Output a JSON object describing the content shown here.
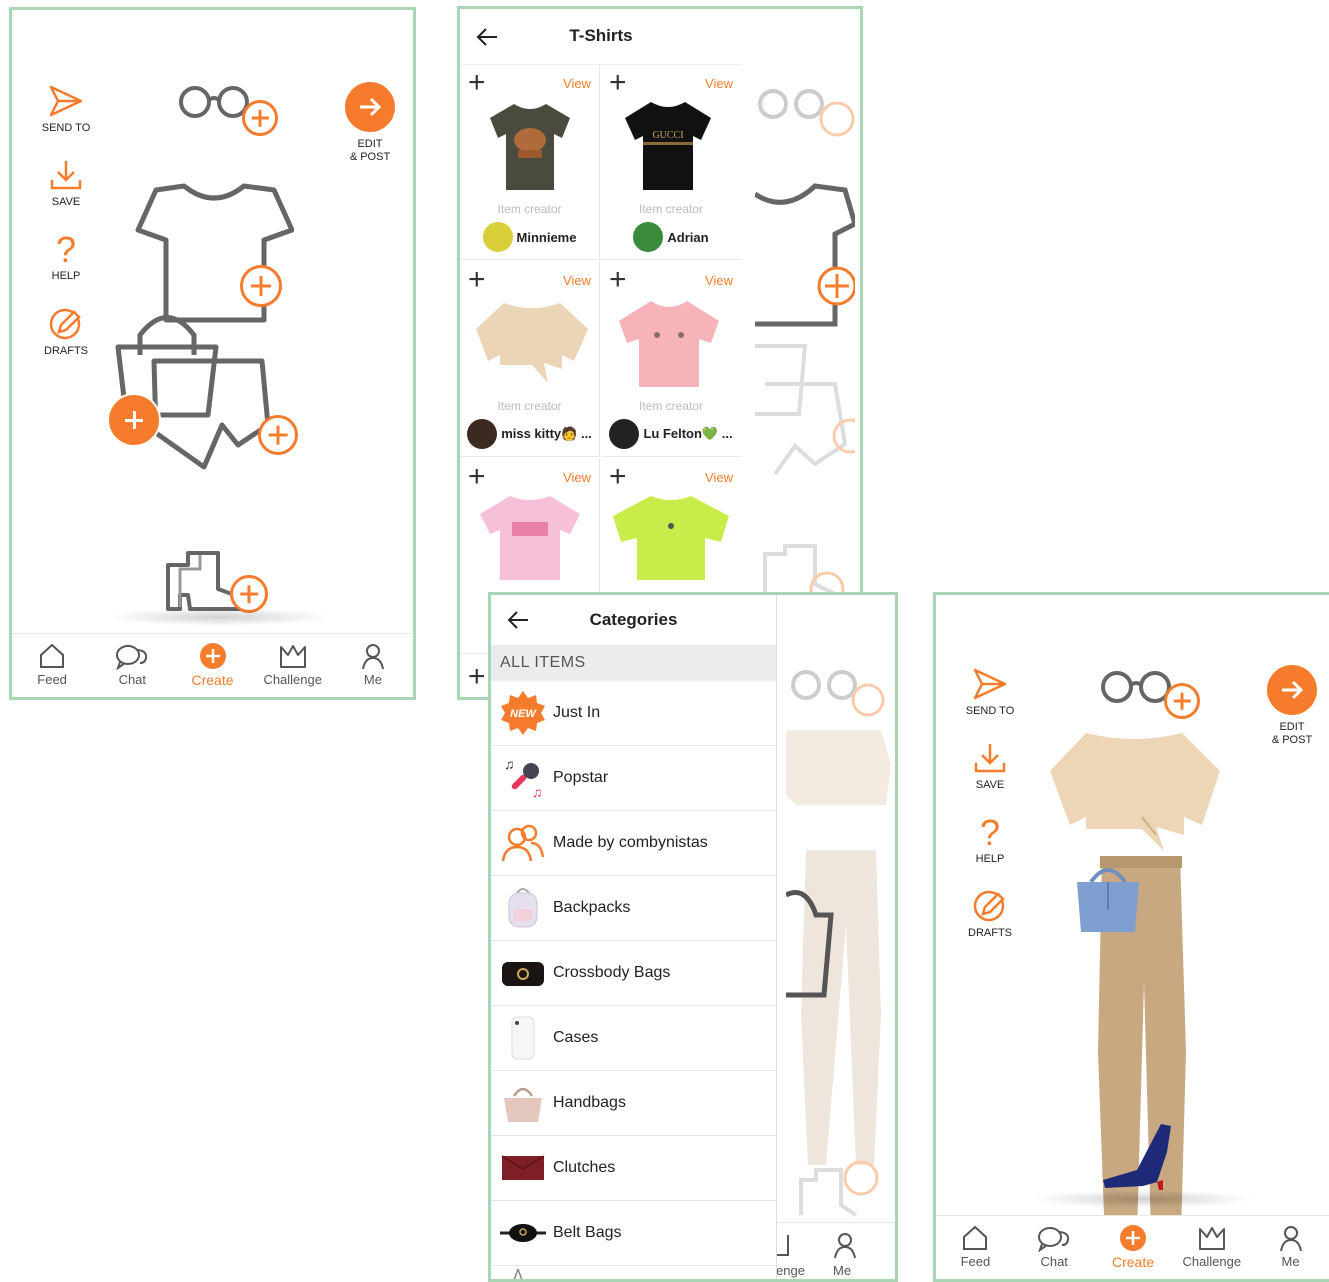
{
  "colors": {
    "accent": "#f47c2c",
    "frame": "#a8d5b4"
  },
  "builder": {
    "side_actions": [
      {
        "label": "SEND TO",
        "icon": "send-icon"
      },
      {
        "label": "SAVE",
        "icon": "download-icon"
      },
      {
        "label": "HELP",
        "icon": "question-icon"
      },
      {
        "label": "DRAFTS",
        "icon": "pencil-icon"
      }
    ],
    "edit_post_line1": "EDIT",
    "edit_post_line2": "& POST"
  },
  "nav": [
    {
      "label": "Feed",
      "icon": "home-icon"
    },
    {
      "label": "Chat",
      "icon": "chat-icon"
    },
    {
      "label": "Create",
      "icon": "plus-icon",
      "active": true
    },
    {
      "label": "Challenge",
      "icon": "crown-icon"
    },
    {
      "label": "Me",
      "icon": "user-icon"
    }
  ],
  "tshirts": {
    "title": "T-Shirts",
    "items": [
      {
        "view": "View",
        "creator_label": "Item creator",
        "creator": "Minnieme"
      },
      {
        "view": "View",
        "creator_label": "Item creator",
        "creator": "Adrian"
      },
      {
        "view": "View",
        "creator_label": "Item creator",
        "creator": "miss kitty🧑 ..."
      },
      {
        "view": "View",
        "creator_label": "Item creator",
        "creator": "Lu Felton💚 ..."
      },
      {
        "view": "View"
      },
      {
        "view": "View"
      }
    ]
  },
  "categories": {
    "title": "Categories",
    "all_items": "ALL ITEMS",
    "items": [
      {
        "label": "Just In",
        "badge": "NEW"
      },
      {
        "label": "Popstar"
      },
      {
        "label": "Made by combynistas"
      },
      {
        "label": "Backpacks"
      },
      {
        "label": "Crossbody Bags"
      },
      {
        "label": "Cases"
      },
      {
        "label": "Handbags"
      },
      {
        "label": "Clutches"
      },
      {
        "label": "Belt Bags"
      }
    ],
    "partial_nav": [
      "enge",
      "Me"
    ]
  }
}
